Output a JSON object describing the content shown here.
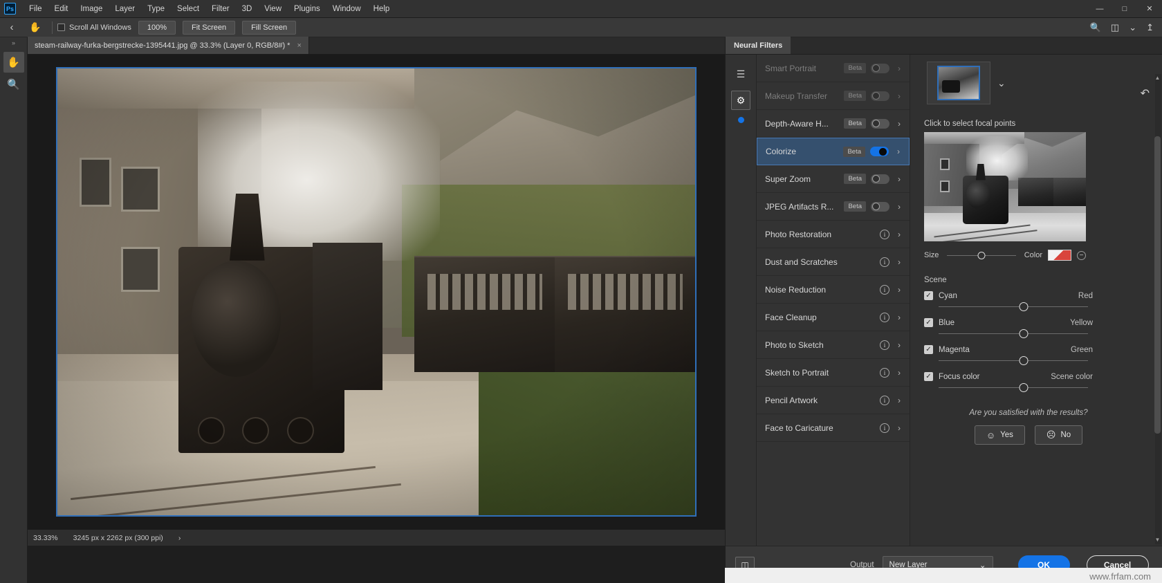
{
  "app": {
    "logo": "Ps",
    "menus": [
      "File",
      "Edit",
      "Image",
      "Layer",
      "Type",
      "Select",
      "Filter",
      "3D",
      "View",
      "Plugins",
      "Window",
      "Help"
    ],
    "window_controls": [
      "minimize",
      "maximize",
      "close"
    ]
  },
  "options_bar": {
    "back_icon": "chevron-left-icon",
    "tool_icon": "hand-icon",
    "scroll_all_windows": "Scroll All Windows",
    "zoom_100": "100%",
    "fit_screen": "Fit Screen",
    "fill_screen": "Fill Screen",
    "right_icons": [
      "search-icon",
      "workspace-icon",
      "chevron-down-icon",
      "share-icon"
    ]
  },
  "toolbar": {
    "expand": "»",
    "tools": [
      {
        "name": "hand-tool",
        "glyph": "✋",
        "active": true
      },
      {
        "name": "zoom-tool",
        "glyph": "🔍",
        "active": false
      }
    ]
  },
  "document": {
    "tab_title": "steam-railway-furka-bergstrecke-1395441.jpg @ 33.3% (Layer 0, RGB/8#) *",
    "close_glyph": "×"
  },
  "status_bar": {
    "zoom": "33.33%",
    "dimensions": "3245 px x 2262 px (300 ppi)",
    "arrow": "›"
  },
  "neural_filters": {
    "panel_tab": "Neural Filters",
    "rail_icons": [
      "sliders-icon",
      "flask-icon"
    ],
    "filters": [
      {
        "name": "Smart Portrait",
        "badge": "Beta",
        "control": "toggle",
        "on": false,
        "enabled": false,
        "selected": false
      },
      {
        "name": "Makeup Transfer",
        "badge": "Beta",
        "control": "toggle",
        "on": false,
        "enabled": false,
        "selected": false
      },
      {
        "name": "Depth-Aware H...",
        "badge": "Beta",
        "control": "toggle",
        "on": false,
        "enabled": true,
        "selected": false
      },
      {
        "name": "Colorize",
        "badge": "Beta",
        "control": "toggle",
        "on": true,
        "enabled": true,
        "selected": true
      },
      {
        "name": "Super Zoom",
        "badge": "Beta",
        "control": "toggle",
        "on": false,
        "enabled": true,
        "selected": false
      },
      {
        "name": "JPEG Artifacts R...",
        "badge": "Beta",
        "control": "toggle",
        "on": false,
        "enabled": true,
        "selected": false
      },
      {
        "name": "Photo Restoration",
        "badge": "",
        "control": "info",
        "on": false,
        "enabled": true,
        "selected": false
      },
      {
        "name": "Dust and Scratches",
        "badge": "",
        "control": "info",
        "on": false,
        "enabled": true,
        "selected": false
      },
      {
        "name": "Noise Reduction",
        "badge": "",
        "control": "info",
        "on": false,
        "enabled": true,
        "selected": false
      },
      {
        "name": "Face Cleanup",
        "badge": "",
        "control": "info",
        "on": false,
        "enabled": true,
        "selected": false
      },
      {
        "name": "Photo to Sketch",
        "badge": "",
        "control": "info",
        "on": false,
        "enabled": true,
        "selected": false
      },
      {
        "name": "Sketch to Portrait",
        "badge": "",
        "control": "info",
        "on": false,
        "enabled": true,
        "selected": false
      },
      {
        "name": "Pencil Artwork",
        "badge": "",
        "control": "info",
        "on": false,
        "enabled": true,
        "selected": false
      },
      {
        "name": "Face to Caricature",
        "badge": "",
        "control": "info",
        "on": false,
        "enabled": true,
        "selected": false
      }
    ],
    "preset": {
      "thumb_name": "preset-thumbnail",
      "chevron": "⌄",
      "reset_icon": "reset-icon"
    },
    "focal": {
      "label": "Click to select focal points",
      "size_label": "Size",
      "size_value": 50,
      "color_label": "Color",
      "remove_glyph": "−"
    },
    "scene": {
      "title": "Scene",
      "sliders": [
        {
          "left_label": "Cyan",
          "right_label": "Red",
          "checked": true,
          "value": 57
        },
        {
          "left_label": "Blue",
          "right_label": "Yellow",
          "checked": true,
          "value": 57
        },
        {
          "left_label": "Magenta",
          "right_label": "Green",
          "checked": true,
          "value": 57
        },
        {
          "left_label": "Focus color",
          "right_label": "Scene color",
          "checked": true,
          "value": 57
        }
      ],
      "check_glyph": "✓"
    },
    "feedback": {
      "question": "Are you satisfied with the results?",
      "yes": "Yes",
      "no": "No",
      "yes_icon": "smiley-happy-icon",
      "no_icon": "smiley-sad-icon",
      "yes_glyph": "☺",
      "no_glyph": "☹"
    },
    "footer": {
      "compare_icon": "compare-icon",
      "output_label": "Output",
      "output_value": "New Layer",
      "output_chevron": "⌄",
      "ok": "OK",
      "cancel": "Cancel"
    },
    "scroll": {
      "up": "▲",
      "down": "▼"
    }
  },
  "watermark": "www.frfam.com",
  "colors": {
    "accent_blue": "#1473e6",
    "selection_blue": "#35506e",
    "panel_bg": "#323232",
    "canvas_bg": "#1a1a1a",
    "toggle_on": "#1473e6"
  }
}
